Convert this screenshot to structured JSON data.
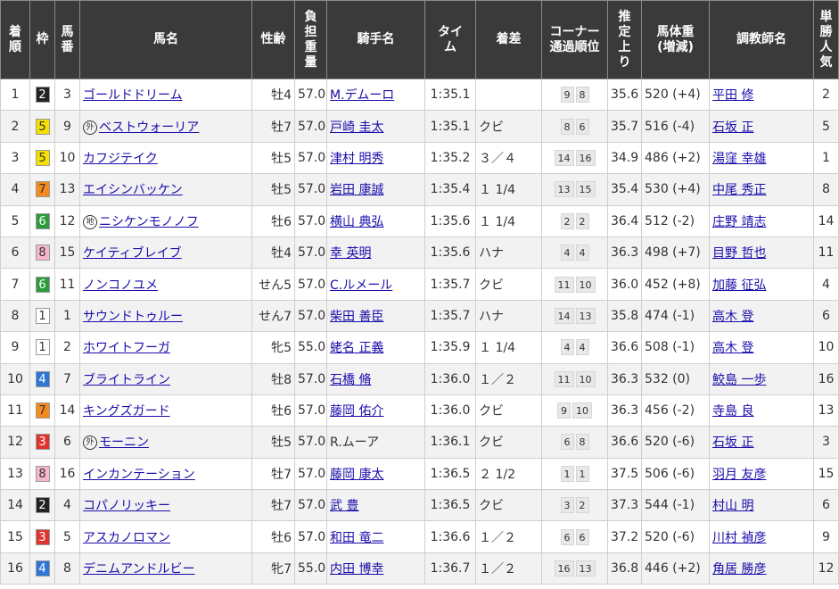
{
  "headers": {
    "rank": "着順",
    "waku": "枠",
    "num": "馬番",
    "horse": "馬名",
    "sexage": "性齢",
    "weight": "負担重量",
    "jockey": "騎手名",
    "time": "タイム",
    "margin": "着差",
    "corner": "コーナー通過順位",
    "last3f": "推定上り",
    "bodyweight": "馬体重(増減)",
    "trainer": "調教師名",
    "popularity": "単勝人気"
  },
  "waku_colors": {
    "1": {
      "bg": "#ffffff",
      "fg": "#333333"
    },
    "2": {
      "bg": "#222222",
      "fg": "#ffffff"
    },
    "3": {
      "bg": "#e0332f",
      "fg": "#ffffff"
    },
    "4": {
      "bg": "#2f75d6",
      "fg": "#ffffff"
    },
    "5": {
      "bg": "#f5e000",
      "fg": "#333333"
    },
    "6": {
      "bg": "#2e9a3c",
      "fg": "#ffffff"
    },
    "7": {
      "bg": "#f58a1f",
      "fg": "#333333"
    },
    "8": {
      "bg": "#f7b6cc",
      "fg": "#333333"
    }
  },
  "rows": [
    {
      "rank": "1",
      "waku": "2",
      "num": "3",
      "mark": "",
      "horse": "ゴールドドリーム",
      "sexage": "牡4",
      "weight": "57.0",
      "jockey": "M.デムーロ",
      "jockey_link": true,
      "time": "1:35.1",
      "margin": "",
      "c1": "9",
      "c2": "8",
      "last3f": "35.6",
      "bw": "520 (+4)",
      "trainer": "平田 修",
      "pop": "2"
    },
    {
      "rank": "2",
      "waku": "5",
      "num": "9",
      "mark": "外",
      "horse": "ベストウォーリア",
      "sexage": "牡7",
      "weight": "57.0",
      "jockey": "戸崎 圭太",
      "jockey_link": true,
      "time": "1:35.1",
      "margin": "クビ",
      "c1": "8",
      "c2": "6",
      "last3f": "35.7",
      "bw": "516 (-4)",
      "trainer": "石坂 正",
      "pop": "5"
    },
    {
      "rank": "3",
      "waku": "5",
      "num": "10",
      "mark": "",
      "horse": "カフジテイク",
      "sexage": "牡5",
      "weight": "57.0",
      "jockey": "津村 明秀",
      "jockey_link": true,
      "time": "1:35.2",
      "margin": "３／４",
      "c1": "14",
      "c2": "16",
      "last3f": "34.9",
      "bw": "486 (+2)",
      "trainer": "湯窪 幸雄",
      "pop": "1"
    },
    {
      "rank": "4",
      "waku": "7",
      "num": "13",
      "mark": "",
      "horse": "エイシンバッケン",
      "sexage": "牡5",
      "weight": "57.0",
      "jockey": "岩田 康誠",
      "jockey_link": true,
      "time": "1:35.4",
      "margin": "１ 1/4",
      "c1": "13",
      "c2": "15",
      "last3f": "35.4",
      "bw": "530 (+4)",
      "trainer": "中尾 秀正",
      "pop": "8"
    },
    {
      "rank": "5",
      "waku": "6",
      "num": "12",
      "mark": "地",
      "horse": "ニシケンモノノフ",
      "sexage": "牡6",
      "weight": "57.0",
      "jockey": "横山 典弘",
      "jockey_link": true,
      "time": "1:35.6",
      "margin": "１ 1/4",
      "c1": "2",
      "c2": "2",
      "last3f": "36.4",
      "bw": "512 (-2)",
      "trainer": "庄野 靖志",
      "pop": "14"
    },
    {
      "rank": "6",
      "waku": "8",
      "num": "15",
      "mark": "",
      "horse": "ケイティブレイブ",
      "sexage": "牡4",
      "weight": "57.0",
      "jockey": "幸 英明",
      "jockey_link": true,
      "time": "1:35.6",
      "margin": "ハナ",
      "c1": "4",
      "c2": "4",
      "last3f": "36.3",
      "bw": "498 (+7)",
      "trainer": "目野 哲也",
      "pop": "11"
    },
    {
      "rank": "7",
      "waku": "6",
      "num": "11",
      "mark": "",
      "horse": "ノンコノユメ",
      "sexage": "せん5",
      "weight": "57.0",
      "jockey": "C.ルメール",
      "jockey_link": true,
      "time": "1:35.7",
      "margin": "クビ",
      "c1": "11",
      "c2": "10",
      "last3f": "36.0",
      "bw": "452 (+8)",
      "trainer": "加藤 征弘",
      "pop": "4"
    },
    {
      "rank": "8",
      "waku": "1",
      "num": "1",
      "mark": "",
      "horse": "サウンドトゥルー",
      "sexage": "せん7",
      "weight": "57.0",
      "jockey": "柴田 善臣",
      "jockey_link": true,
      "time": "1:35.7",
      "margin": "ハナ",
      "c1": "14",
      "c2": "13",
      "last3f": "35.8",
      "bw": "474 (-1)",
      "trainer": "高木 登",
      "pop": "6"
    },
    {
      "rank": "9",
      "waku": "1",
      "num": "2",
      "mark": "",
      "horse": "ホワイトフーガ",
      "sexage": "牝5",
      "weight": "55.0",
      "jockey": "蛯名 正義",
      "jockey_link": true,
      "time": "1:35.9",
      "margin": "１ 1/4",
      "c1": "4",
      "c2": "4",
      "last3f": "36.6",
      "bw": "508 (-1)",
      "trainer": "高木 登",
      "pop": "10"
    },
    {
      "rank": "10",
      "waku": "4",
      "num": "7",
      "mark": "",
      "horse": "ブライトライン",
      "sexage": "牡8",
      "weight": "57.0",
      "jockey": "石橋 脩",
      "jockey_link": true,
      "time": "1:36.0",
      "margin": "１／２",
      "c1": "11",
      "c2": "10",
      "last3f": "36.3",
      "bw": "532 (0)",
      "trainer": "鮫島 一歩",
      "pop": "16"
    },
    {
      "rank": "11",
      "waku": "7",
      "num": "14",
      "mark": "",
      "horse": "キングズガード",
      "sexage": "牡6",
      "weight": "57.0",
      "jockey": "藤岡 佑介",
      "jockey_link": true,
      "time": "1:36.0",
      "margin": "クビ",
      "c1": "9",
      "c2": "10",
      "last3f": "36.3",
      "bw": "456 (-2)",
      "trainer": "寺島 良",
      "pop": "13"
    },
    {
      "rank": "12",
      "waku": "3",
      "num": "6",
      "mark": "外",
      "horse": "モーニン",
      "sexage": "牡5",
      "weight": "57.0",
      "jockey": "R.ムーア",
      "jockey_link": false,
      "time": "1:36.1",
      "margin": "クビ",
      "c1": "6",
      "c2": "8",
      "last3f": "36.6",
      "bw": "520 (-6)",
      "trainer": "石坂 正",
      "pop": "3"
    },
    {
      "rank": "13",
      "waku": "8",
      "num": "16",
      "mark": "",
      "horse": "インカンテーション",
      "sexage": "牡7",
      "weight": "57.0",
      "jockey": "藤岡 康太",
      "jockey_link": true,
      "time": "1:36.5",
      "margin": "２ 1/2",
      "c1": "1",
      "c2": "1",
      "last3f": "37.5",
      "bw": "506 (-6)",
      "trainer": "羽月 友彦",
      "pop": "15"
    },
    {
      "rank": "14",
      "waku": "2",
      "num": "4",
      "mark": "",
      "horse": "コパノリッキー",
      "sexage": "牡7",
      "weight": "57.0",
      "jockey": "武 豊",
      "jockey_link": true,
      "time": "1:36.5",
      "margin": "クビ",
      "c1": "3",
      "c2": "2",
      "last3f": "37.3",
      "bw": "544 (-1)",
      "trainer": "村山 明",
      "pop": "6"
    },
    {
      "rank": "15",
      "waku": "3",
      "num": "5",
      "mark": "",
      "horse": "アスカノロマン",
      "sexage": "牡6",
      "weight": "57.0",
      "jockey": "和田 竜二",
      "jockey_link": true,
      "time": "1:36.6",
      "margin": "１／２",
      "c1": "6",
      "c2": "6",
      "last3f": "37.2",
      "bw": "520 (-6)",
      "trainer": "川村 禎彦",
      "pop": "9"
    },
    {
      "rank": "16",
      "waku": "4",
      "num": "8",
      "mark": "",
      "horse": "デニムアンドルビー",
      "sexage": "牝7",
      "weight": "55.0",
      "jockey": "内田 博幸",
      "jockey_link": true,
      "time": "1:36.7",
      "margin": "１／２",
      "c1": "16",
      "c2": "13",
      "last3f": "36.8",
      "bw": "446 (+2)",
      "trainer": "角居 勝彦",
      "pop": "12"
    }
  ]
}
